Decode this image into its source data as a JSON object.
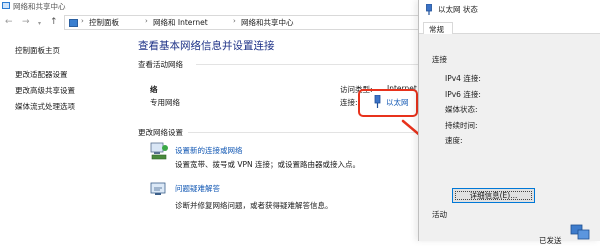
{
  "window": {
    "title": "网络和共享中心"
  },
  "nav": {
    "back": "←",
    "forward": "→",
    "up": "↑"
  },
  "breadcrumb": [
    "控制面板",
    "网络和 Internet",
    "网络和共享中心"
  ],
  "breadcrumb_sep": "›",
  "sidebar": {
    "items": [
      {
        "label": "控制面板主页"
      },
      {
        "label": "更改适配器设置"
      },
      {
        "label": "更改高级共享设置"
      },
      {
        "label": "媒体流式处理选项"
      }
    ]
  },
  "main": {
    "title": "查看基本网络信息并设置连接",
    "active_networks_header": "查看活动网络",
    "network_name": "络",
    "network_type": "专用网络",
    "access_type_label": "访问类型:",
    "access_type_value": "Internet",
    "connections_label": "连接:",
    "connection_link": "以太网",
    "change_settings_header": "更改网络设置",
    "setup_link": "设置新的连接或网络",
    "setup_desc": "设置宽带、拨号或 VPN 连接；或设置路由器或接入点。",
    "troubleshoot_link": "问题疑难解答",
    "troubleshoot_desc": "诊断并修复网络问题，或者获得疑难解答信息。"
  },
  "dialog": {
    "title": "以太网 状态",
    "tab": "常规",
    "connection_header": "连接",
    "ipv4_label": "IPv4 连接:",
    "ipv6_label": "IPv6 连接:",
    "media_label": "媒体状态:",
    "duration_label": "持续时间:",
    "speed_label": "速度:",
    "details_button": "详细信息(E)...",
    "activity_header": "活动",
    "sent_label": "已发送"
  },
  "colors": {
    "accent": "#0f56b3",
    "title": "#1e3287",
    "highlight": "#e8321c"
  }
}
